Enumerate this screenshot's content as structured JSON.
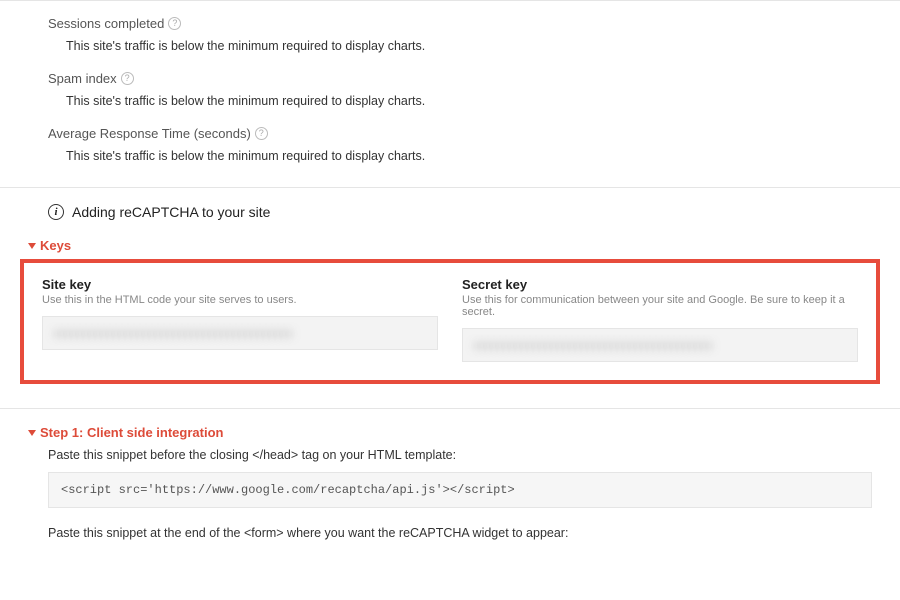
{
  "metrics": {
    "sessions": {
      "title": "Sessions completed",
      "msg": "This site's traffic is below the minimum required to display charts."
    },
    "spam": {
      "title": "Spam index",
      "msg": "This site's traffic is below the minimum required to display charts."
    },
    "art": {
      "title": "Average Response Time (seconds)",
      "msg": "This site's traffic is below the minimum required to display charts."
    }
  },
  "adding": {
    "title": "Adding reCAPTCHA to your site"
  },
  "keys": {
    "heading": "Keys",
    "site": {
      "label": "Site key",
      "desc": "Use this in the HTML code your site serves to users.",
      "value": "xxxxxxxxxxxxxxxxxxxxxxxxxxxxxxxxxxxxxxxx"
    },
    "secret": {
      "label": "Secret key",
      "desc": "Use this for communication between your site and Google. Be sure to keep it a secret.",
      "value": "xxxxxxxxxxxxxxxxxxxxxxxxxxxxxxxxxxxxxxxx"
    }
  },
  "step1": {
    "heading": "Step 1: Client side integration",
    "line1": "Paste this snippet before the closing </head> tag on your HTML template:",
    "code": "<script src='https://www.google.com/recaptcha/api.js'></script>",
    "line2": "Paste this snippet at the end of the <form> where you want the reCAPTCHA widget to appear:"
  }
}
